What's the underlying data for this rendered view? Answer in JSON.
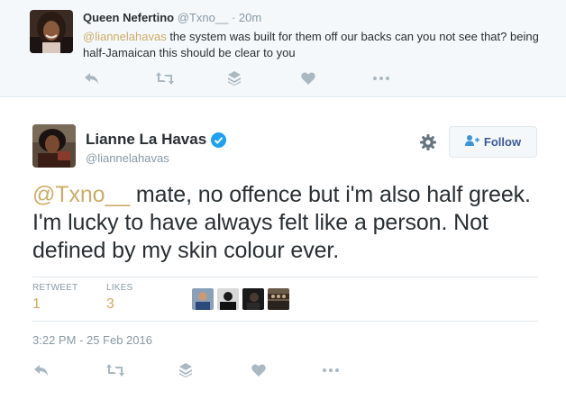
{
  "reply": {
    "name": "Queen Nefertino",
    "handle": "@Txno__",
    "time": "· 20m",
    "mention": "@liannelahavas",
    "text_line": " the system was built for them off our backs can you not see that? being half-Jamaican this should be clear to you"
  },
  "tweet": {
    "name": "Lianne La Havas",
    "handle": "@liannelahavas",
    "follow_label": "Follow",
    "mention": "@Txno__",
    "text": " mate, no offence but i'm also half greek. I'm lucky to have always felt like a person. Not defined by my skin colour ever.",
    "retweets_label": "RETWEET",
    "retweets_value": "1",
    "likes_label": "LIKES",
    "likes_value": "3",
    "timestamp": "3:22 PM - 25 Feb 2016"
  },
  "icons": [
    "reply-icon",
    "retweet-icon",
    "stack-icon",
    "heart-icon",
    "more-icon",
    "gear-icon",
    "verified-icon",
    "follow-person-icon"
  ],
  "colors": {
    "mention": "#ccac68",
    "muted": "#8899a6",
    "verified": "#1da1f2",
    "follow_text": "#3b5998",
    "background_reply": "#f5f8fa"
  }
}
